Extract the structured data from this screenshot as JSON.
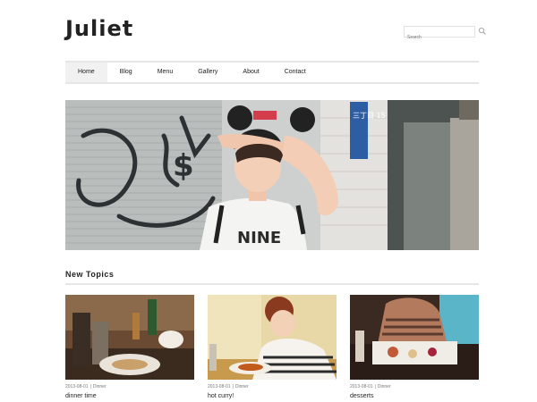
{
  "site": {
    "title": "Juliet"
  },
  "search": {
    "placeholder": "Search",
    "icon": "search-icon"
  },
  "nav": {
    "items": [
      {
        "label": "Home",
        "active": true
      },
      {
        "label": "Blog"
      },
      {
        "label": "Menu"
      },
      {
        "label": "Gallery"
      },
      {
        "label": "About"
      },
      {
        "label": "Contact"
      }
    ]
  },
  "hero": {
    "shirt_text": "NINE",
    "sign_text": "三丁目 15"
  },
  "section": {
    "title": "New Topics"
  },
  "posts": [
    {
      "date": "2013-08-01",
      "category": "Dinner",
      "title": "dinner time"
    },
    {
      "date": "2013-08-01",
      "category": "Dinner",
      "title": "hot curry!"
    },
    {
      "date": "2013-08-01",
      "category": "Dinner",
      "title": "desserts"
    }
  ]
}
